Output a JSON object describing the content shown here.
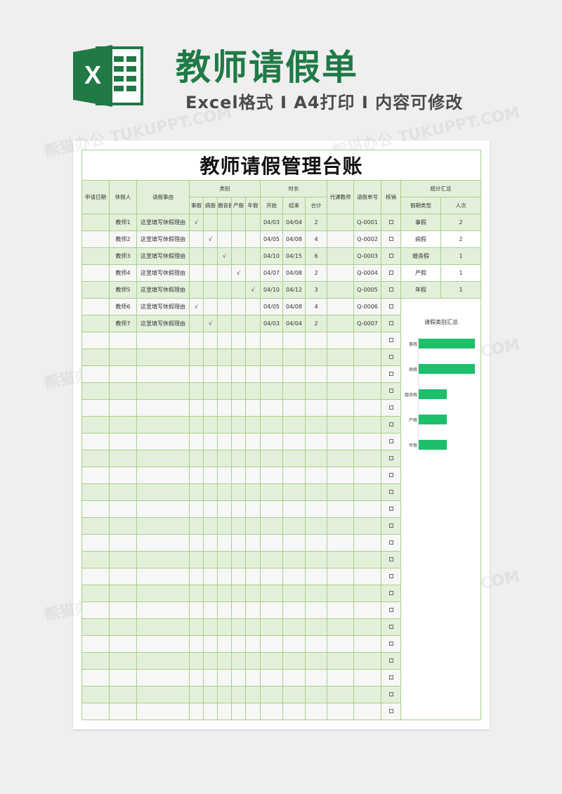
{
  "header": {
    "title": "教师请假单",
    "subtitle": "Excel格式 I A4打印 I 内容可修改"
  },
  "watermark": "熊猫办公 TUKUPPT.COM",
  "sheet": {
    "title": "教师请假管理台账",
    "headers": {
      "date": "申请日期",
      "person": "休假人",
      "reason": "请假事由",
      "category": "类别",
      "categories": [
        "事假",
        "病假",
        "婚丧假",
        "产假",
        "年假"
      ],
      "duration": "时长",
      "duration_cols": [
        "开始",
        "结束",
        "合计"
      ],
      "substitute": "代课教师",
      "leave_no": "请假单号",
      "cancel": "核销",
      "stats": "统计汇总",
      "stats_type": "假期类型",
      "stats_count": "人次"
    },
    "rows": [
      {
        "date": "",
        "person": "教师1",
        "reason": "这里填写休假理由",
        "check": 0,
        "start": "04/03",
        "end": "04/04",
        "total": "2",
        "sub": "",
        "no": "Q-0001"
      },
      {
        "date": "",
        "person": "教师2",
        "reason": "这里填写休假理由",
        "check": 1,
        "start": "04/05",
        "end": "04/08",
        "total": "4",
        "sub": "",
        "no": "Q-0002"
      },
      {
        "date": "",
        "person": "教师3",
        "reason": "这里填写休假理由",
        "check": 2,
        "start": "04/10",
        "end": "04/15",
        "total": "6",
        "sub": "",
        "no": "Q-0003"
      },
      {
        "date": "",
        "person": "教师4",
        "reason": "这里填写休假理由",
        "check": 3,
        "start": "04/07",
        "end": "04/08",
        "total": "2",
        "sub": "",
        "no": "Q-0004"
      },
      {
        "date": "",
        "person": "教师5",
        "reason": "这里填写休假理由",
        "check": 4,
        "start": "04/10",
        "end": "04/12",
        "total": "3",
        "sub": "",
        "no": "Q-0005"
      },
      {
        "date": "",
        "person": "教师6",
        "reason": "这里填写休假理由",
        "check": 0,
        "start": "04/05",
        "end": "04/08",
        "total": "4",
        "sub": "",
        "no": "Q-0006"
      },
      {
        "date": "",
        "person": "教师7",
        "reason": "这里填写休假理由",
        "check": 1,
        "start": "04/03",
        "end": "04/04",
        "total": "2",
        "sub": "",
        "no": "Q-0007"
      }
    ],
    "check_mark": "√",
    "blank_rows": 23,
    "stats": [
      {
        "type": "事假",
        "count": "2"
      },
      {
        "type": "病假",
        "count": "2"
      },
      {
        "type": "婚丧假",
        "count": "1"
      },
      {
        "type": "产假",
        "count": "1"
      },
      {
        "type": "年假",
        "count": "1"
      }
    ]
  },
  "chart_data": {
    "type": "bar",
    "orientation": "horizontal",
    "title": "请假类别汇总",
    "categories": [
      "事假",
      "病假",
      "婚丧假",
      "产假",
      "年假"
    ],
    "values": [
      2,
      2,
      1,
      1,
      1
    ],
    "color": "#1cc06a"
  }
}
